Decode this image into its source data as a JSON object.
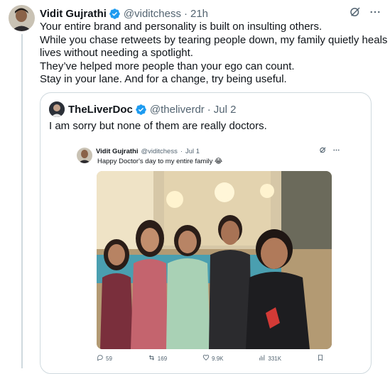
{
  "post": {
    "author_name": "Vidit Gujrathi",
    "handle": "@viditchess",
    "dot": "·",
    "time": "21h",
    "lines": [
      "Your entire brand and personality is built on insulting others.",
      "While you chase retweets by tearing people down, my family quietly heals",
      "lives without needing a spotlight.",
      "They’ve helped more people than your ego can count.",
      "Stay in your lane. And for a change, try being useful."
    ]
  },
  "quote": {
    "author_name": "TheLiverDoc",
    "handle": "@theliverdr",
    "dot": "·",
    "date": "Jul 2",
    "text": "I am sorry but none of them are really doctors."
  },
  "embedded": {
    "author_name": "Vidit Gujrathi",
    "handle": "@viditchess",
    "dot": "·",
    "date": "Jul 1",
    "text": "Happy Doctor's day to my entire family 😂",
    "stats": {
      "replies": "59",
      "reposts": "169",
      "likes": "9.9K",
      "views": "331K"
    }
  },
  "icons": [
    "verified-icon",
    "grok-icon",
    "more-icon",
    "reply-icon",
    "repost-icon",
    "like-icon",
    "views-icon",
    "bookmark-icon"
  ],
  "colors": {
    "verified": "#1d9bf0",
    "text": "#0f1419",
    "muted": "#536471",
    "border": "#cfd9de"
  }
}
